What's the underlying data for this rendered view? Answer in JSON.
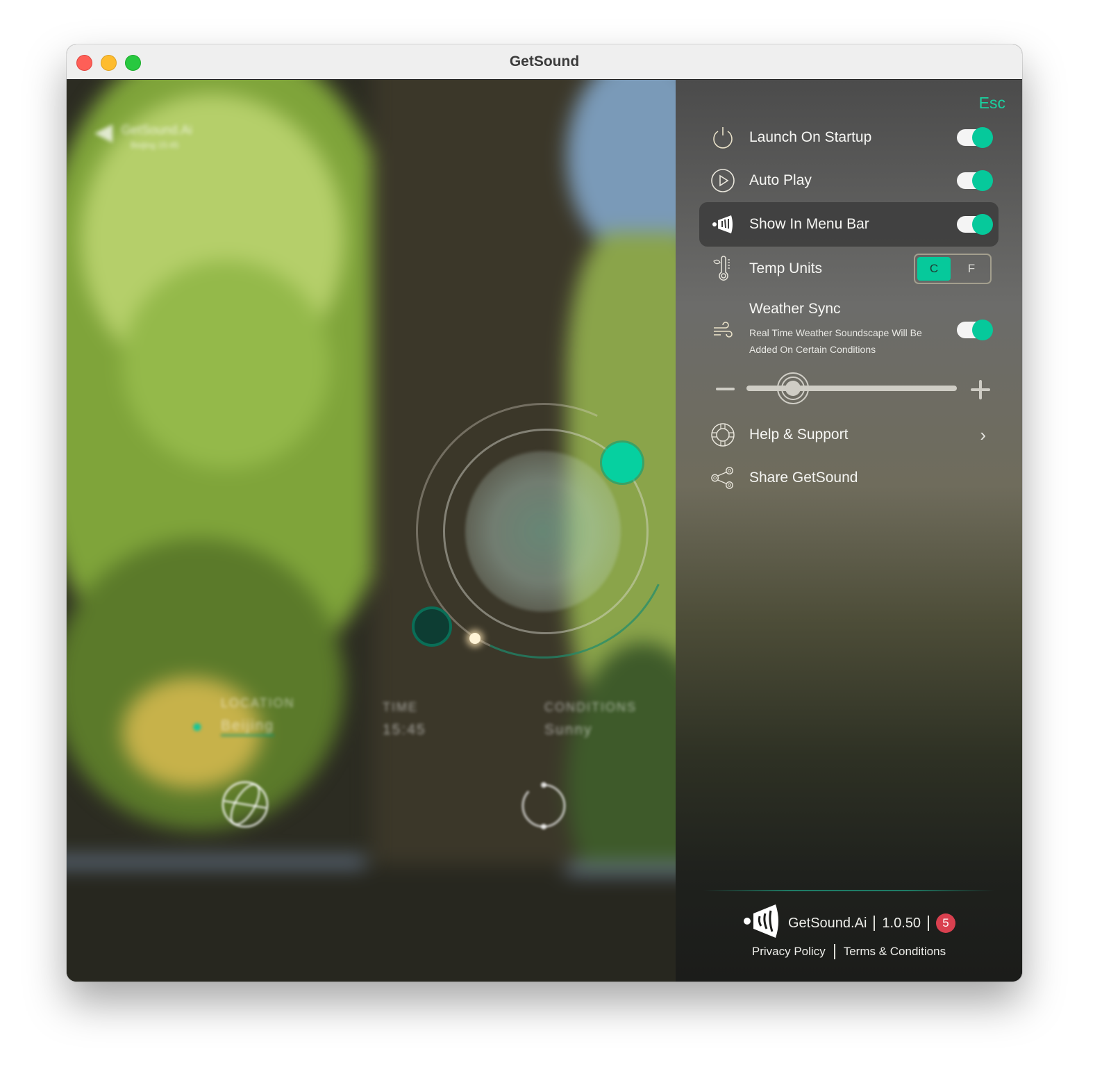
{
  "window": {
    "title": "GetSound",
    "controls": [
      "close",
      "minimize",
      "maximize"
    ]
  },
  "scene": {
    "brand_blurred": "GetSound.Ai",
    "brand_sub_blurred": "Beijing 15:45",
    "location_label": "LOCATION",
    "location_value": "Beijing",
    "time_label": "TIME",
    "time_value": "15:45",
    "conditions_label": "CONDITIONS",
    "conditions_value": "Sunny",
    "icons": [
      "globe-icon",
      "refresh-icon",
      "location-pin-icon"
    ]
  },
  "settings": {
    "esc_label": "Esc",
    "items": [
      {
        "label": "Launch On Startup",
        "icon": "power-icon",
        "control": "toggle",
        "on": true
      },
      {
        "label": "Auto Play",
        "icon": "play-circle-icon",
        "control": "toggle",
        "on": true
      },
      {
        "label": "Show In Menu Bar",
        "icon": "getsound-logo-icon",
        "control": "toggle",
        "on": true,
        "highlighted": true
      },
      {
        "label": "Temp Units",
        "icon": "thermometer-icon",
        "control": "segmented",
        "options": [
          "C",
          "F"
        ],
        "selected": "C"
      },
      {
        "label": "Weather Sync",
        "icon": "wind-icon",
        "control": "toggle",
        "on": true,
        "description_line1": "Real Time Weather Soundscape Will Be",
        "description_line2": "Added On Certain Conditions"
      }
    ],
    "volume": {
      "value_fraction": 0.22,
      "minus_label": "−",
      "plus_label": "+"
    },
    "links": [
      {
        "label": "Help & Support",
        "icon": "lifebuoy-icon",
        "chevron": true
      },
      {
        "label": "Share GetSound",
        "icon": "share-icon"
      }
    ]
  },
  "footer": {
    "brand": "GetSound.Ai",
    "version": "1.0.50",
    "badge_count": "5",
    "privacy_label": "Privacy Policy",
    "terms_label": "Terms & Conditions"
  },
  "colors": {
    "accent": "#06c99b",
    "badge": "#d9404f",
    "esc": "#1ad1a0"
  }
}
